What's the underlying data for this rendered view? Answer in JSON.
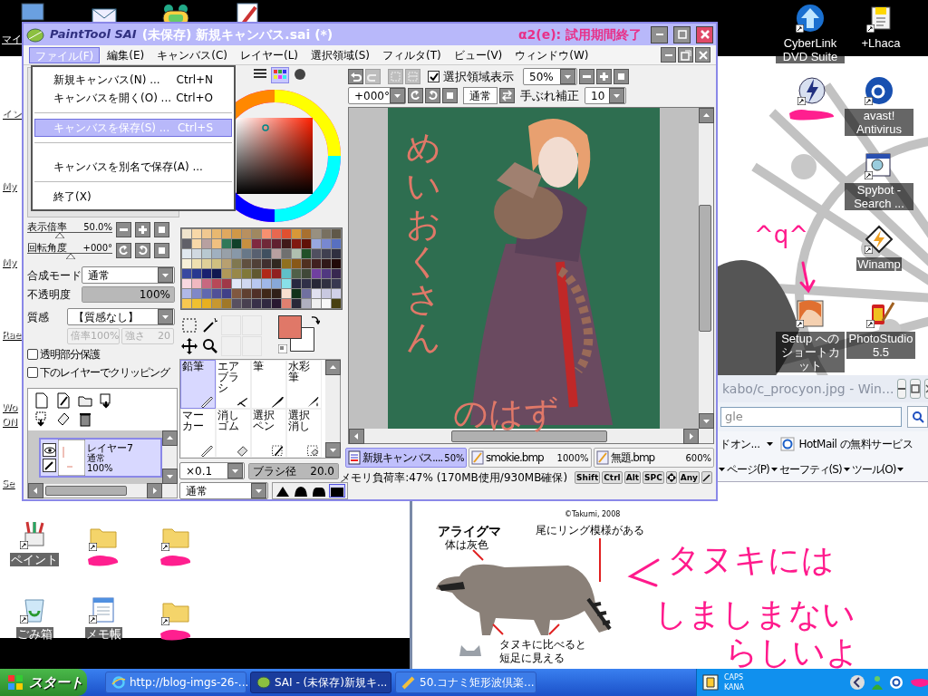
{
  "desktop": {
    "edge_labels": [
      {
        "label": "マイ"
      },
      {
        "label": "イン"
      },
      {
        "label": "My"
      },
      {
        "label": "My"
      },
      {
        "label": "Rae"
      },
      {
        "label": "Wo"
      },
      {
        "label": "ON"
      },
      {
        "label": "Se"
      }
    ],
    "top_icons": [
      {
        "kind": "computer"
      },
      {
        "kind": "mail"
      },
      {
        "kind": "game"
      },
      {
        "kind": "brush"
      }
    ],
    "right_icons": [
      {
        "kind": "upload",
        "label": "CyberLink DVD Suite"
      },
      {
        "kind": "archive",
        "label": "+Lhaca"
      },
      {
        "kind": "bolt"
      },
      {
        "kind": "avast",
        "label": "avast! Antivirus"
      },
      {
        "kind": "spybot",
        "label": "Spybot - Search ..."
      },
      {
        "kind": "winamp",
        "label": "Winamp"
      },
      {
        "kind": "portrait",
        "label": "Setup へのショートカット"
      },
      {
        "kind": "film",
        "label": "PhotoStudio 5.5"
      }
    ],
    "bottom_icons": [
      {
        "kind": "paint",
        "label": "ペイント"
      },
      {
        "kind": "folder"
      },
      {
        "kind": "folder"
      },
      {
        "kind": "recycle",
        "label": "ごみ箱"
      },
      {
        "kind": "notepad",
        "label": "メモ帳"
      },
      {
        "kind": "folder"
      }
    ],
    "scribble_note": "^q^",
    "handwriting": [
      "タヌキには",
      "しましまない",
      "らしいよ"
    ]
  },
  "browser": {
    "title": "kabo/c_procyon.jpg - Win...",
    "search_value": "gle",
    "links": [
      "ドオン...",
      "HotMail の無料サービス"
    ],
    "commands": [
      "ページ(P)",
      "セーフティ(S)",
      "ツール(O)"
    ],
    "figure": {
      "title": "アライグマ",
      "credit": "©Takumi, 2008",
      "callouts": [
        "体は灰色",
        "尾にリング模様がある",
        "タヌキに比べると",
        "短足に見える"
      ]
    }
  },
  "sai": {
    "logo": "PaintTool SAI",
    "title": "(未保存) 新規キャンバス.sai (*)",
    "trial": "α2(e): 試用期間終了",
    "menus": [
      {
        "label": "ファイル(F)",
        "selected": true
      },
      {
        "label": "編集(E)",
        "selected": false
      },
      {
        "label": "キャンバス(C)",
        "selected": false
      },
      {
        "label": "レイヤー(L)",
        "selected": false
      },
      {
        "label": "選択領域(S)",
        "selected": false
      },
      {
        "label": "フィルタ(T)",
        "selected": false
      },
      {
        "label": "ビュー(V)",
        "selected": false
      },
      {
        "label": "ウィンドウ(W)",
        "selected": false
      }
    ],
    "file_menu": [
      {
        "kind": "item",
        "label": "新規キャンバス(N) ...",
        "shortcut": "Ctrl+N",
        "selected": false
      },
      {
        "kind": "item",
        "label": "キャンバスを開く(O) ...",
        "shortcut": "Ctrl+O",
        "selected": false
      },
      {
        "kind": "separator"
      },
      {
        "kind": "item",
        "label": "キャンバスを保存(S) ...",
        "shortcut": "Ctrl+S",
        "selected": true
      },
      {
        "kind": "separator"
      },
      {
        "kind": "gap"
      },
      {
        "kind": "item",
        "label": "キャンバスを別名で保存(A) ...",
        "selected": false
      },
      {
        "kind": "separator"
      },
      {
        "kind": "item",
        "label": "終了(X)",
        "selected": false
      }
    ],
    "navigator": [
      {
        "label": "表示倍率",
        "reading": "50.0%",
        "level": 0.38
      },
      {
        "label": "回転角度",
        "reading": "+000°",
        "level": 0.51
      }
    ],
    "blend_label": "合成モード",
    "blend_value": "通常",
    "opacity_label": "不透明度",
    "opacity": {
      "reading": "100%",
      "level": 1
    },
    "texture_label": "質感",
    "texture_value": "【質感なし】",
    "texture_scale": "倍率",
    "texture_scale_value": "100%",
    "texture_strength": "強さ",
    "texture_strength_value": "20",
    "checks": [
      {
        "label": "透明部分保護",
        "checked": false
      },
      {
        "label": "下のレイヤーでクリッピング",
        "checked": false
      }
    ],
    "layers": [
      {
        "name": "レイヤー7",
        "mode": "通常",
        "opacity": "100%",
        "selected": true,
        "visible": true
      }
    ],
    "swatches": [
      {
        "color": "#f0e4cc"
      },
      {
        "color": "#f8d8a8"
      },
      {
        "color": "#f0c890"
      },
      {
        "color": "#e8b870"
      },
      {
        "color": "#e0a860"
      },
      {
        "color": "#d09848"
      },
      {
        "color": "#b89060"
      },
      {
        "color": "#a08860"
      },
      {
        "color": "#f89070"
      },
      {
        "color": "#e86850"
      },
      {
        "color": "#e05030"
      },
      {
        "color": "#d89838"
      },
      {
        "color": "#a87030"
      },
      {
        "color": "#989080"
      },
      {
        "color": "#787060"
      },
      {
        "color": "#605848"
      },
      {
        "color": "#606068"
      },
      {
        "color": "#f8d8a8"
      },
      {
        "color": "#b8a0a0"
      },
      {
        "color": "#f0c080"
      },
      {
        "color": "#307858"
      },
      {
        "color": "#104028"
      },
      {
        "color": "#c89040"
      },
      {
        "color": "#802840"
      },
      {
        "color": "#702838"
      },
      {
        "color": "#602030"
      },
      {
        "color": "#401818"
      },
      {
        "color": "#801810"
      },
      {
        "color": "#601008"
      },
      {
        "color": "#98a8e0"
      },
      {
        "color": "#7888d0"
      },
      {
        "color": "#5870c0"
      },
      {
        "color": "#e0e8f0"
      },
      {
        "color": "#d0d8e0"
      },
      {
        "color": "#b8c8d0"
      },
      {
        "color": "#a0b0c0"
      },
      {
        "color": "#98a0a8"
      },
      {
        "color": "#8898a8"
      },
      {
        "color": "#687888"
      },
      {
        "color": "#586070"
      },
      {
        "color": "#405060"
      },
      {
        "color": "#b8a0a0"
      },
      {
        "color": "#707070"
      },
      {
        "color": "#b0c0b0"
      },
      {
        "color": "#205028"
      },
      {
        "color": "#505060"
      },
      {
        "color": "#404050"
      },
      {
        "color": "#303040"
      },
      {
        "color": "#f8f0d8"
      },
      {
        "color": "#f0e0b0"
      },
      {
        "color": "#e0d098"
      },
      {
        "color": "#d0c080"
      },
      {
        "color": "#b8a070"
      },
      {
        "color": "#807850"
      },
      {
        "color": "#605040"
      },
      {
        "color": "#504038"
      },
      {
        "color": "#403030"
      },
      {
        "color": "#302820"
      },
      {
        "color": "#907020"
      },
      {
        "color": "#885818"
      },
      {
        "color": "#503020"
      },
      {
        "color": "#402020"
      },
      {
        "color": "#301818"
      },
      {
        "color": "#200808"
      },
      {
        "color": "#3848a0"
      },
      {
        "color": "#283890"
      },
      {
        "color": "#182070"
      },
      {
        "color": "#101850"
      },
      {
        "color": "#b09858"
      },
      {
        "color": "#988848"
      },
      {
        "color": "#807838"
      },
      {
        "color": "#605830"
      },
      {
        "color": "#b02818"
      },
      {
        "color": "#902020"
      },
      {
        "color": "#60c0c8"
      },
      {
        "color": "#506048"
      },
      {
        "color": "#404838"
      },
      {
        "color": "#7040a0"
      },
      {
        "color": "#503880"
      },
      {
        "color": "#382850"
      },
      {
        "color": "#f8d8e0"
      },
      {
        "color": "#f0b8c0"
      },
      {
        "color": "#c86880"
      },
      {
        "color": "#b84858"
      },
      {
        "color": "#a03848"
      },
      {
        "color": "#e0e8f8"
      },
      {
        "color": "#d0d8f0"
      },
      {
        "color": "#b8c8f0"
      },
      {
        "color": "#a0b8e8"
      },
      {
        "color": "#88a8d8"
      },
      {
        "color": "#88e0e8"
      },
      {
        "color": "#282840"
      },
      {
        "color": "#303048"
      },
      {
        "color": "#282838"
      },
      {
        "color": "#303040"
      },
      {
        "color": "#383850"
      },
      {
        "color": "#b0b8e8"
      },
      {
        "color": "#8088c8"
      },
      {
        "color": "#6068b0"
      },
      {
        "color": "#505098"
      },
      {
        "color": "#404088"
      },
      {
        "color": "#805840"
      },
      {
        "color": "#604030"
      },
      {
        "color": "#503028"
      },
      {
        "color": "#402818"
      },
      {
        "color": "#302018"
      },
      {
        "color": "#f8e0d0"
      },
      {
        "color": "#103018"
      },
      {
        "color": "#7070a0"
      },
      {
        "color": "#e0e0f0"
      },
      {
        "color": "#c8c8e0"
      },
      {
        "color": "#d0d0e8"
      },
      {
        "color": "#f8c850"
      },
      {
        "color": "#f0c030"
      },
      {
        "color": "#e8b020"
      },
      {
        "color": "#c89830"
      },
      {
        "color": "#a07828"
      },
      {
        "color": "#585060"
      },
      {
        "color": "#484050"
      },
      {
        "color": "#383048"
      },
      {
        "color": "#302840"
      },
      {
        "color": "#281830"
      },
      {
        "color": "#e08070"
      },
      {
        "color": "#282838"
      },
      {
        "color": "#b0b0c0"
      },
      {
        "color": "#f0f0f0"
      },
      {
        "color": "#f8f8f8"
      },
      {
        "color": "#484010"
      }
    ],
    "foreground": {
      "color": "#e07868"
    },
    "tools": [
      {
        "label": "鉛筆",
        "kind": "pencil",
        "selected": true
      },
      {
        "label": "エアブラシ",
        "kind": "airbrush",
        "selected": false
      },
      {
        "label": "筆",
        "kind": "brush",
        "selected": false
      },
      {
        "label": "水彩筆",
        "kind": "watercolor",
        "selected": false
      },
      {
        "label": "マーカー",
        "kind": "pencil",
        "selected": false
      },
      {
        "label": "消しゴム",
        "kind": "eraser",
        "selected": false
      },
      {
        "label": "選択ペン",
        "kind": "selpen",
        "selected": false
      },
      {
        "label": "選択消し",
        "kind": "selerase",
        "selected": false
      }
    ],
    "size_multiplier": "×0.1",
    "brush_size_label": "ブラシ径",
    "brush_size": {
      "reading": "20.0",
      "level": 1
    },
    "brush_mode": "通常",
    "brush_shapes": [
      {
        "selected": false
      },
      {
        "selected": false
      },
      {
        "selected": false
      },
      {
        "selected": true
      }
    ],
    "show_selection": {
      "label": "選択領域表示",
      "checked": true
    },
    "zoom": "50%",
    "rotation": "+000°",
    "flip_mode": "通常",
    "stabilizer_label": "手ぶれ補正",
    "stabilizer": "10",
    "canvas_note_vertical": "めいおくさん",
    "canvas_note_horizontal": "のはず",
    "tabs": [
      {
        "name": "新規キャンバス....",
        "zoom": "50%",
        "selected": true
      },
      {
        "name": "smokie.bmp",
        "zoom": "1000%",
        "selected": false
      },
      {
        "name": "無題.bmp",
        "zoom": "600%",
        "selected": false
      }
    ],
    "status": "メモリ負荷率:47% (170MB使用/930MB確保)",
    "keys": [
      "Shift",
      "Ctrl",
      "Alt",
      "SPC"
    ],
    "any_key": "Any"
  },
  "taskbar": {
    "start": "スタート",
    "tasks": [
      {
        "label": "http://blog-imgs-26-...",
        "kind": "ie",
        "selected": false
      },
      {
        "label": "SAI - (未保存)新規キ...",
        "kind": "sai",
        "selected": true
      },
      {
        "label": "50.コナミ矩形波倶楽...",
        "kind": "pen",
        "selected": false
      }
    ],
    "caps": "CAPS",
    "kana": "KANA"
  }
}
